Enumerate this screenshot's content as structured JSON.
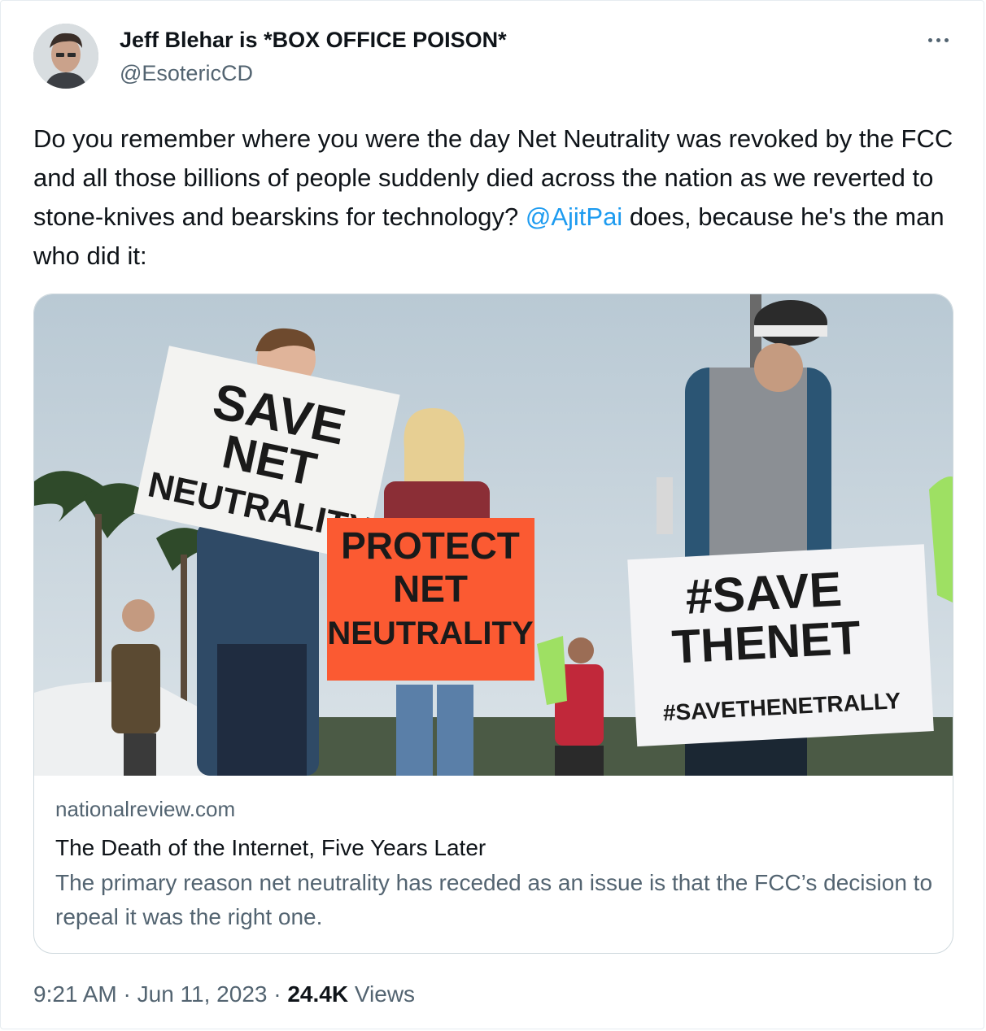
{
  "tweet": {
    "display_name": "Jeff Blehar is *BOX OFFICE POISON*",
    "handle": "@EsotericCD",
    "text_before_mention": "Do you remember where you were the day Net Neutrality was revoked by the FCC and all those billions of people suddenly died across the nation as we reverted to stone-knives and bearskins for technology? ",
    "mention": "@AjitPai",
    "text_after_mention": " does, because he's the man who did it:",
    "time": "9:21 AM",
    "date": "Jun 11, 2023",
    "separator": " · ",
    "views_count": "24.4K",
    "views_label": " Views"
  },
  "link_card": {
    "domain": "nationalreview.com",
    "title": "The Death of the Internet, Five Years Later",
    "description": "The primary reason net neutrality has receded as an issue is that the FCC’s decision to repeal it was the right one."
  },
  "signs": {
    "left": [
      "SAVE",
      "NET",
      "NEUTRALITY"
    ],
    "center": [
      "PROTECT",
      "NET",
      "NEUTRALITY"
    ],
    "right_big": [
      "#SAVE",
      "THENET"
    ],
    "right_small": "#SAVETHENETRALLY"
  },
  "icons": {
    "more": "more-horizontal-icon"
  },
  "colors": {
    "link": "#1d9bf0",
    "secondary_text": "#536471",
    "primary_text": "#0f1419",
    "orange_sign": "#fb5a32"
  }
}
